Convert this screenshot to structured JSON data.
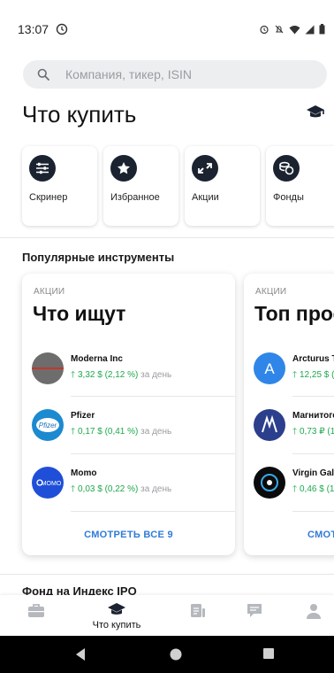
{
  "status_bar": {
    "time": "13:07"
  },
  "search": {
    "placeholder": "Компания, тикер, ISIN"
  },
  "header": {
    "title": "Что купить"
  },
  "categories": [
    {
      "label": "Скринер",
      "icon": "sliders-icon"
    },
    {
      "label": "Избранное",
      "icon": "star-icon"
    },
    {
      "label": "Акции",
      "icon": "arrows-icon"
    },
    {
      "label": "Фонды",
      "icon": "coins-icon"
    }
  ],
  "popular": {
    "title": "Популярные инструменты",
    "cards": [
      {
        "kicker": "АКЦИИ",
        "title": "Что ищут",
        "items": [
          {
            "name": "Moderna Inc",
            "change": "3,32 $ (2,12 %)",
            "period": "за день"
          },
          {
            "name": "Pfizer",
            "change": "0,17 $ (0,41 %)",
            "period": "за день"
          },
          {
            "name": "Momo",
            "change": "0,03 $ (0,22 %)",
            "period": "за день"
          }
        ],
        "see_all": "СМОТРЕТЬ ВСЕ 9"
      },
      {
        "kicker": "АКЦИИ",
        "title": "Топ прос",
        "items": [
          {
            "name": "Arcturus T",
            "change": "12,25 $ (",
            "period": ""
          },
          {
            "name": "Магнитогс",
            "change": "0,73 ₽ (1",
            "period": ""
          },
          {
            "name": "Virgin Gala",
            "change": "0,46 $ (1",
            "period": ""
          }
        ],
        "see_all": "СМОТ"
      }
    ]
  },
  "next_section": {
    "title": "Фонд на Индекс IPO"
  },
  "bottom_nav": {
    "items": [
      {
        "label": "",
        "icon": "briefcase-icon"
      },
      {
        "label": "Что купить",
        "icon": "graduation-cap-icon"
      },
      {
        "label": "",
        "icon": "document-icon"
      },
      {
        "label": "",
        "icon": "chat-icon"
      },
      {
        "label": "",
        "icon": "profile-icon"
      }
    ]
  },
  "colors": {
    "accent": "#2f7bd8",
    "positive": "#1ea84c",
    "icon_dark": "#1b2230",
    "nav_inactive": "#b5b8bd"
  }
}
